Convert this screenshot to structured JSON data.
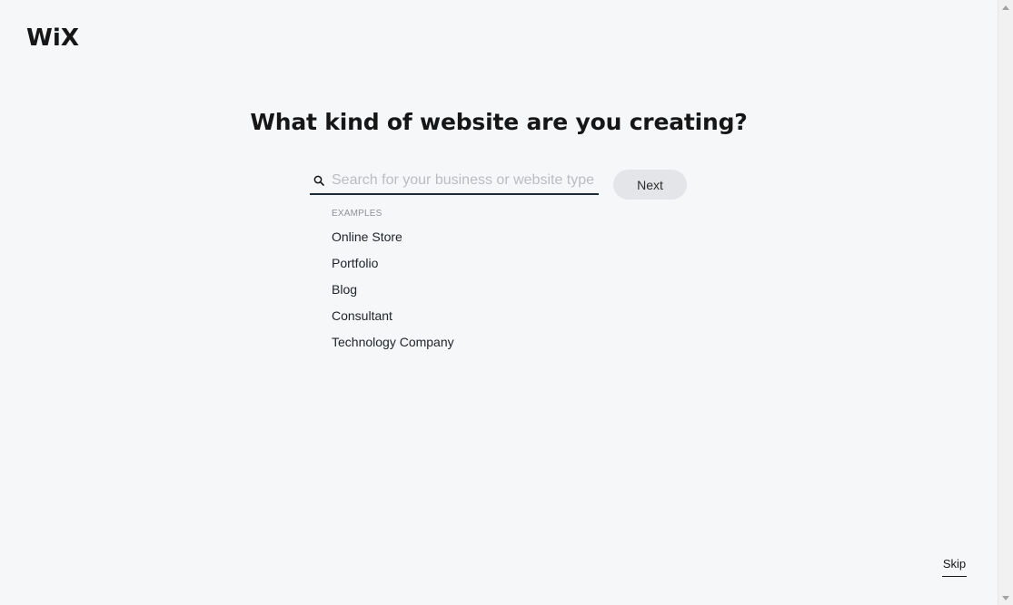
{
  "brand": {
    "logo_text": "WiX"
  },
  "header": {
    "title": "What kind of website are you creating?"
  },
  "search": {
    "placeholder": "Search for your business or website type",
    "value": "",
    "icon": "search-icon",
    "next_label": "Next"
  },
  "examples": {
    "label": "EXAMPLES",
    "items": [
      "Online Store",
      "Portfolio",
      "Blog",
      "Consultant",
      "Technology Company"
    ]
  },
  "footer": {
    "skip_label": "Skip"
  },
  "colors": {
    "background": "#f6f7f9",
    "text": "#161616",
    "input_underline": "#1f2b3a",
    "button_bg": "#e4e5e9"
  }
}
